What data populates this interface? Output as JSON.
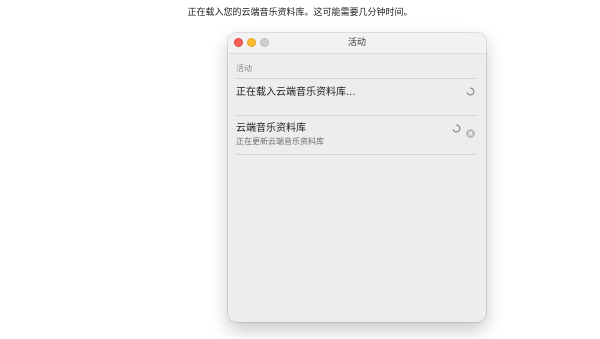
{
  "intro": {
    "text": "正在载入您的云端音乐资料库。这可能需要几分钟时间。"
  },
  "window": {
    "title": "活动",
    "section_header": "活动",
    "items": [
      {
        "title": "正在载入云端音乐资料库...",
        "subtitle": "",
        "status_icon": "spinner-icon"
      },
      {
        "title": "云端音乐资料库",
        "subtitle": "正在更新云端音乐资料库",
        "status_icon": "spinner-icon",
        "action_icon": "stop-icon"
      }
    ]
  },
  "colors": {
    "close": "#ff5f57",
    "minimize": "#febc2e",
    "zoom_inactive": "#cfcfcf",
    "window_bg": "#ededed"
  }
}
